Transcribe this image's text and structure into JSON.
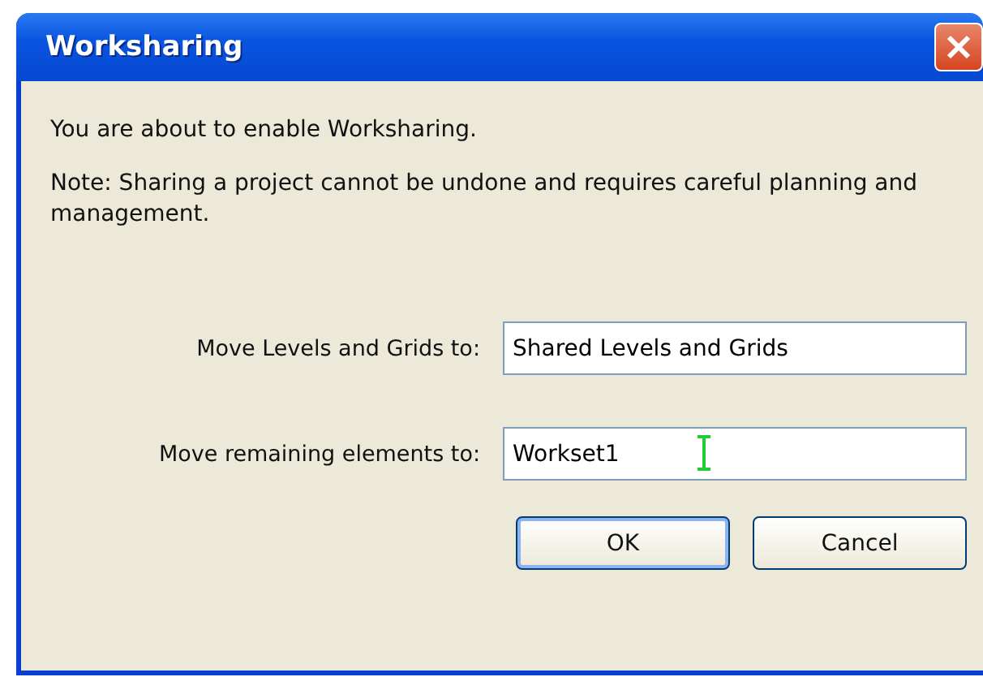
{
  "window": {
    "title": "Worksharing"
  },
  "message": "You are about to enable Worksharing.",
  "note": "Note: Sharing a project cannot be undone and requires careful planning and management.",
  "fields": [
    {
      "label": "Move Levels and Grids to:",
      "value": "Shared Levels and Grids",
      "cursor": false
    },
    {
      "label": "Move remaining elements to:",
      "value": "Workset1",
      "cursor": true
    }
  ],
  "buttons": [
    {
      "label": "OK",
      "default": true
    },
    {
      "label": "Cancel",
      "default": false
    }
  ]
}
